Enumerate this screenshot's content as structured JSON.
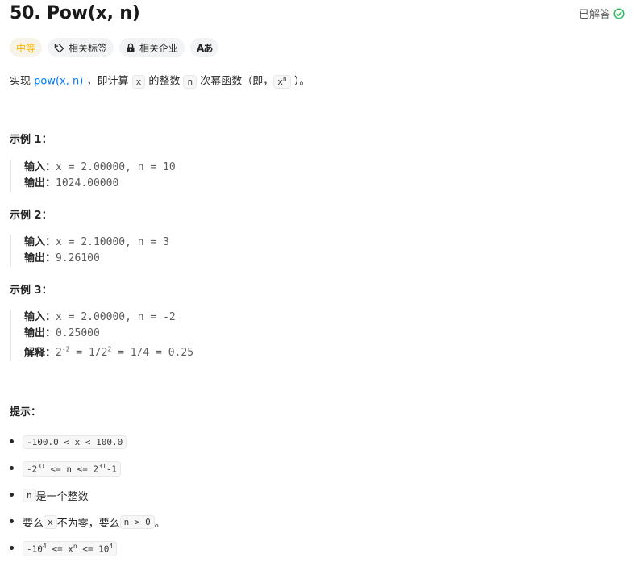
{
  "title": "50. Pow(x, n)",
  "solved_label": "已解答",
  "tags": {
    "difficulty": "中等",
    "topics": "相关标签",
    "companies": "相关企业",
    "translate_glyph": "Aあ"
  },
  "description": {
    "p1": "实现 ",
    "fn": "pow(x, n)",
    "p2": " ，即计算 ",
    "code_x": "x",
    "p3": " 的整数 ",
    "code_n": "n",
    "p4": " 次幂函数（即，",
    "code_xn_base": "x",
    "code_xn_exp": "n",
    "p5": " ）。"
  },
  "examples": [
    {
      "heading": "示例 1：",
      "input_label": "输入：",
      "input": "x = 2.00000, n = 10",
      "output_label": "输出：",
      "output": "1024.00000"
    },
    {
      "heading": "示例 2：",
      "input_label": "输入：",
      "input": "x = 2.10000, n = 3",
      "output_label": "输出：",
      "output": "9.26100"
    },
    {
      "heading": "示例 3：",
      "input_label": "输入：",
      "input": "x = 2.00000, n = -2",
      "output_label": "输出：",
      "output": "0.25000",
      "explain_label": "解释：",
      "explain": {
        "a": "2",
        "a_sup": "-2",
        "b": " = 1/2",
        "b_sup": "2",
        "c": " = 1/4 = 0.25"
      }
    }
  ],
  "hints": {
    "title": "提示：",
    "c1": "-100.0 < x < 100.0",
    "c2": {
      "a": "-2",
      "a_sup": "31",
      "b": " <= n <= 2",
      "b_sup": "31",
      "c": "-1"
    },
    "c3": {
      "code": "n",
      "text": " 是一个整数"
    },
    "c4": {
      "t1": "要么 ",
      "code1": "x",
      "t2": " 不为零，要么 ",
      "code2": "n > 0",
      "t3": " 。"
    },
    "c5": {
      "a": "-10",
      "a_sup": "4",
      "b": " <= x",
      "b_sup": "n",
      "c": " <= 10",
      "c_sup": "4"
    }
  },
  "colors": {
    "difficulty": "#ffb800",
    "solved_check": "#2cbb5d",
    "link": "#007aff"
  },
  "icons": [
    "check-circle-icon",
    "tag-icon",
    "lock-icon",
    "translate-icon"
  ]
}
